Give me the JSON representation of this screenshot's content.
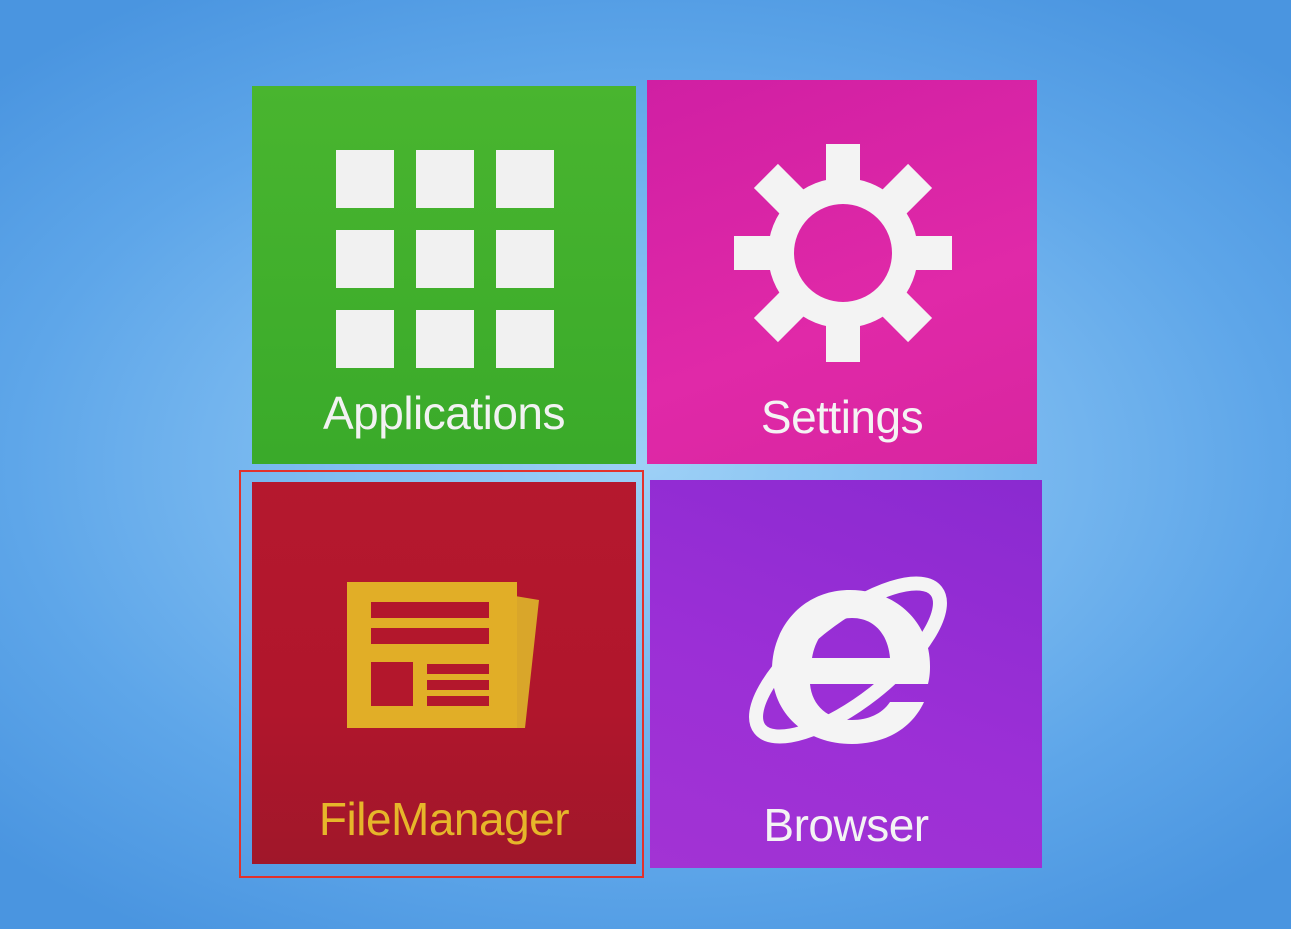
{
  "tiles": {
    "applications": {
      "label": "Applications",
      "icon": "app-grid-icon",
      "color": "#44b02d"
    },
    "settings": {
      "label": "Settings",
      "icon": "gear-icon",
      "color": "#d623a4"
    },
    "filemanager": {
      "label": "FileManager",
      "icon": "document-icon",
      "color": "#b0172d",
      "label_color": "#e6b62a",
      "selected": true
    },
    "browser": {
      "label": "Browser",
      "icon": "internet-explorer-icon",
      "color": "#9530d4"
    }
  },
  "selection_color": "#e2312c",
  "background_color": "#6eb2ee"
}
